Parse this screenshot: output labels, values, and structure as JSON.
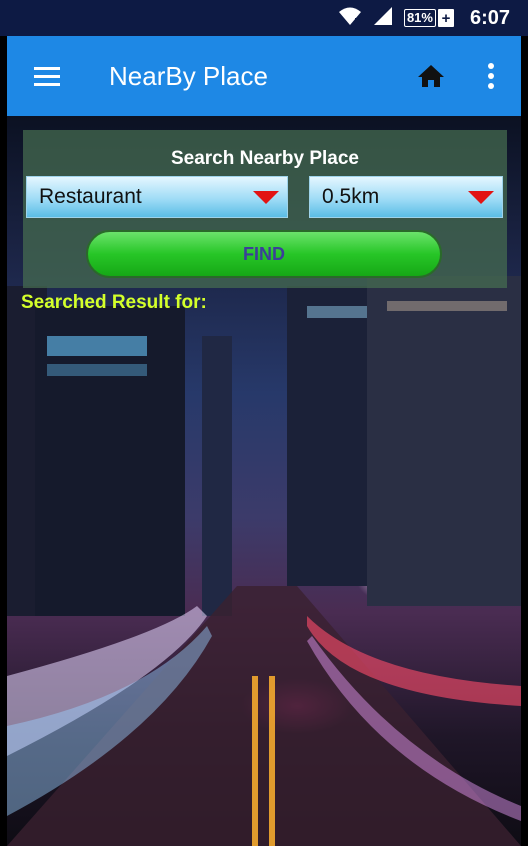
{
  "status_bar": {
    "battery": "81%",
    "time": "6:07",
    "icons": [
      "wifi-icon",
      "signal-icon",
      "battery-charging-icon"
    ]
  },
  "app_bar": {
    "title": "NearBy Place",
    "icons": [
      "menu-icon",
      "home-icon",
      "more-vert-icon"
    ],
    "color": "#1e88e5"
  },
  "search": {
    "title": "Search Nearby Place",
    "place_type": "Restaurant",
    "radius": "0.5km",
    "find_label": "FIND"
  },
  "results": {
    "label": "Searched Result for:"
  },
  "colors": {
    "status_bar": "#0d1a44",
    "result_label": "#d4ff2a",
    "find_button": "#27c627",
    "dropdown_arrow": "#e21313"
  }
}
